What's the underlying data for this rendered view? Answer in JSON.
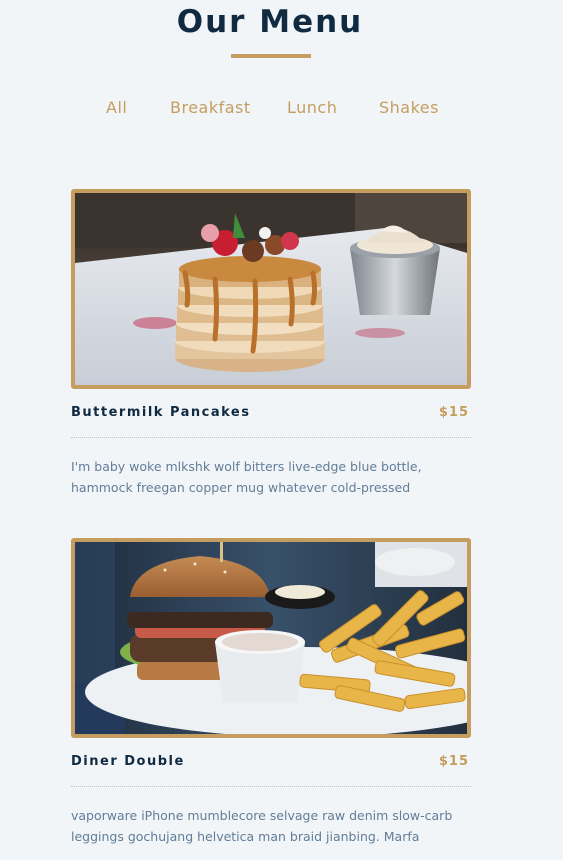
{
  "header": {
    "title": "Our Menu"
  },
  "filters": [
    {
      "label": "All"
    },
    {
      "label": "Breakfast"
    },
    {
      "label": "Lunch"
    },
    {
      "label": "Shakes"
    }
  ],
  "menu": [
    {
      "name": "Buttermilk Pancakes",
      "price": "$15",
      "description": "I'm baby woke mlkshk wolf bitters live-edge blue bottle, hammock freegan copper mug whatever cold-pressed"
    },
    {
      "name": "Diner Double",
      "price": "$15",
      "description": "vaporware iPhone mumblecore selvage raw denim slow-carb leggings gochujang helvetica man braid jianbing. Marfa"
    }
  ],
  "colors": {
    "background": "#f1f5f8",
    "title": "#102a42",
    "accent": "#c59d5f",
    "text": "#617d98"
  }
}
